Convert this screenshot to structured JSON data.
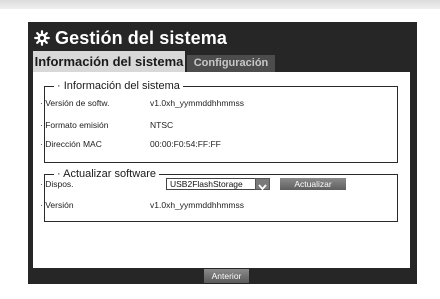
{
  "window": {
    "title": "Gestión del sistema"
  },
  "tabs": [
    {
      "label": "Información del sistema",
      "active": true
    },
    {
      "label": "Configuración",
      "active": false
    }
  ],
  "system_info": {
    "legend": "· Información del sistema",
    "rows": [
      {
        "label": "· Versión de softw.",
        "value": "v1.0xh_yymmddhhmmss"
      },
      {
        "label": "· Formato emisión",
        "value": "NTSC"
      },
      {
        "label": "· Dirección MAC",
        "value": "00:00:F0:54:FF:FF"
      }
    ]
  },
  "update": {
    "legend": "· Actualizar software",
    "device_label": "· Dispos.",
    "device_value": "USB2FlashStorage",
    "update_button": "Actualizar",
    "version_label": "· Versión",
    "version_value": "v1.0xh_yymmddhhmmss"
  },
  "footer": {
    "prev_button": "Anterior"
  },
  "icons": {
    "title_icon": "gear-icon",
    "dropdown_icon": "chevron-down-icon"
  },
  "colors": {
    "window_bg": "#262626",
    "active_tab_bg": "#d8d8d8",
    "inactive_tab_bg": "#4c4c4c",
    "button_bg": "#6e6e6e"
  }
}
